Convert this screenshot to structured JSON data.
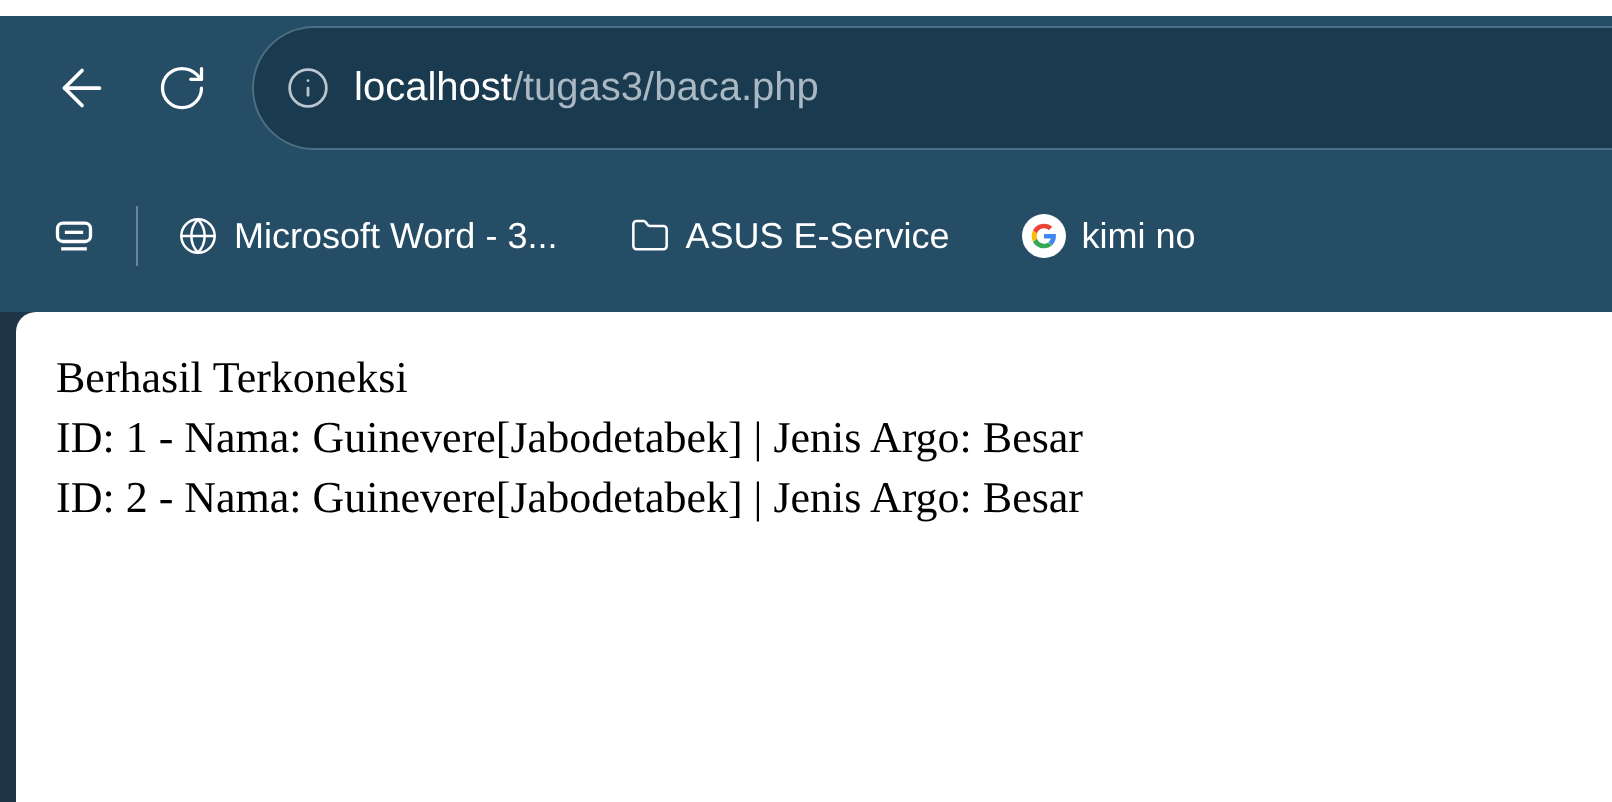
{
  "address_bar": {
    "host": "localhost",
    "path": "/tugas3/baca.php"
  },
  "bookmarks": [
    {
      "kind": "globe",
      "label": "Microsoft Word - 3..."
    },
    {
      "kind": "folder",
      "label": "ASUS E-Service"
    },
    {
      "kind": "google",
      "label": "kimi no"
    }
  ],
  "page": {
    "lines": [
      "Berhasil Terkoneksi",
      "ID: 1 - Nama: Guinevere[Jabodetabek] | Jenis Argo: Besar",
      "ID: 2 - Nama: Guinevere[Jabodetabek] | Jenis Argo: Besar"
    ]
  }
}
